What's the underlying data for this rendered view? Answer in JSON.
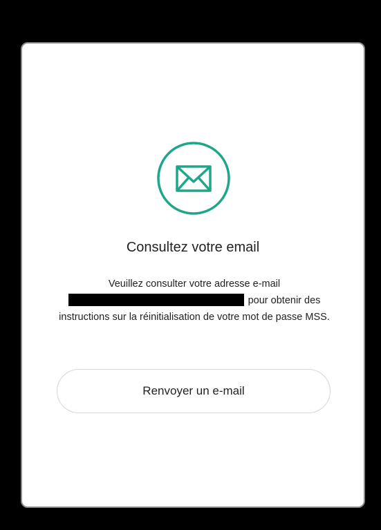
{
  "dialog": {
    "icon": "envelope-icon",
    "accent_color": "#1fa58a",
    "title": "Consultez votre email",
    "message_before": "Veuillez consulter votre adresse e-mail",
    "message_after": "pour obtenir des instructions sur la réinitialisation de votre mot de passe MSS.",
    "resend_label": "Renvoyer un e-mail"
  }
}
